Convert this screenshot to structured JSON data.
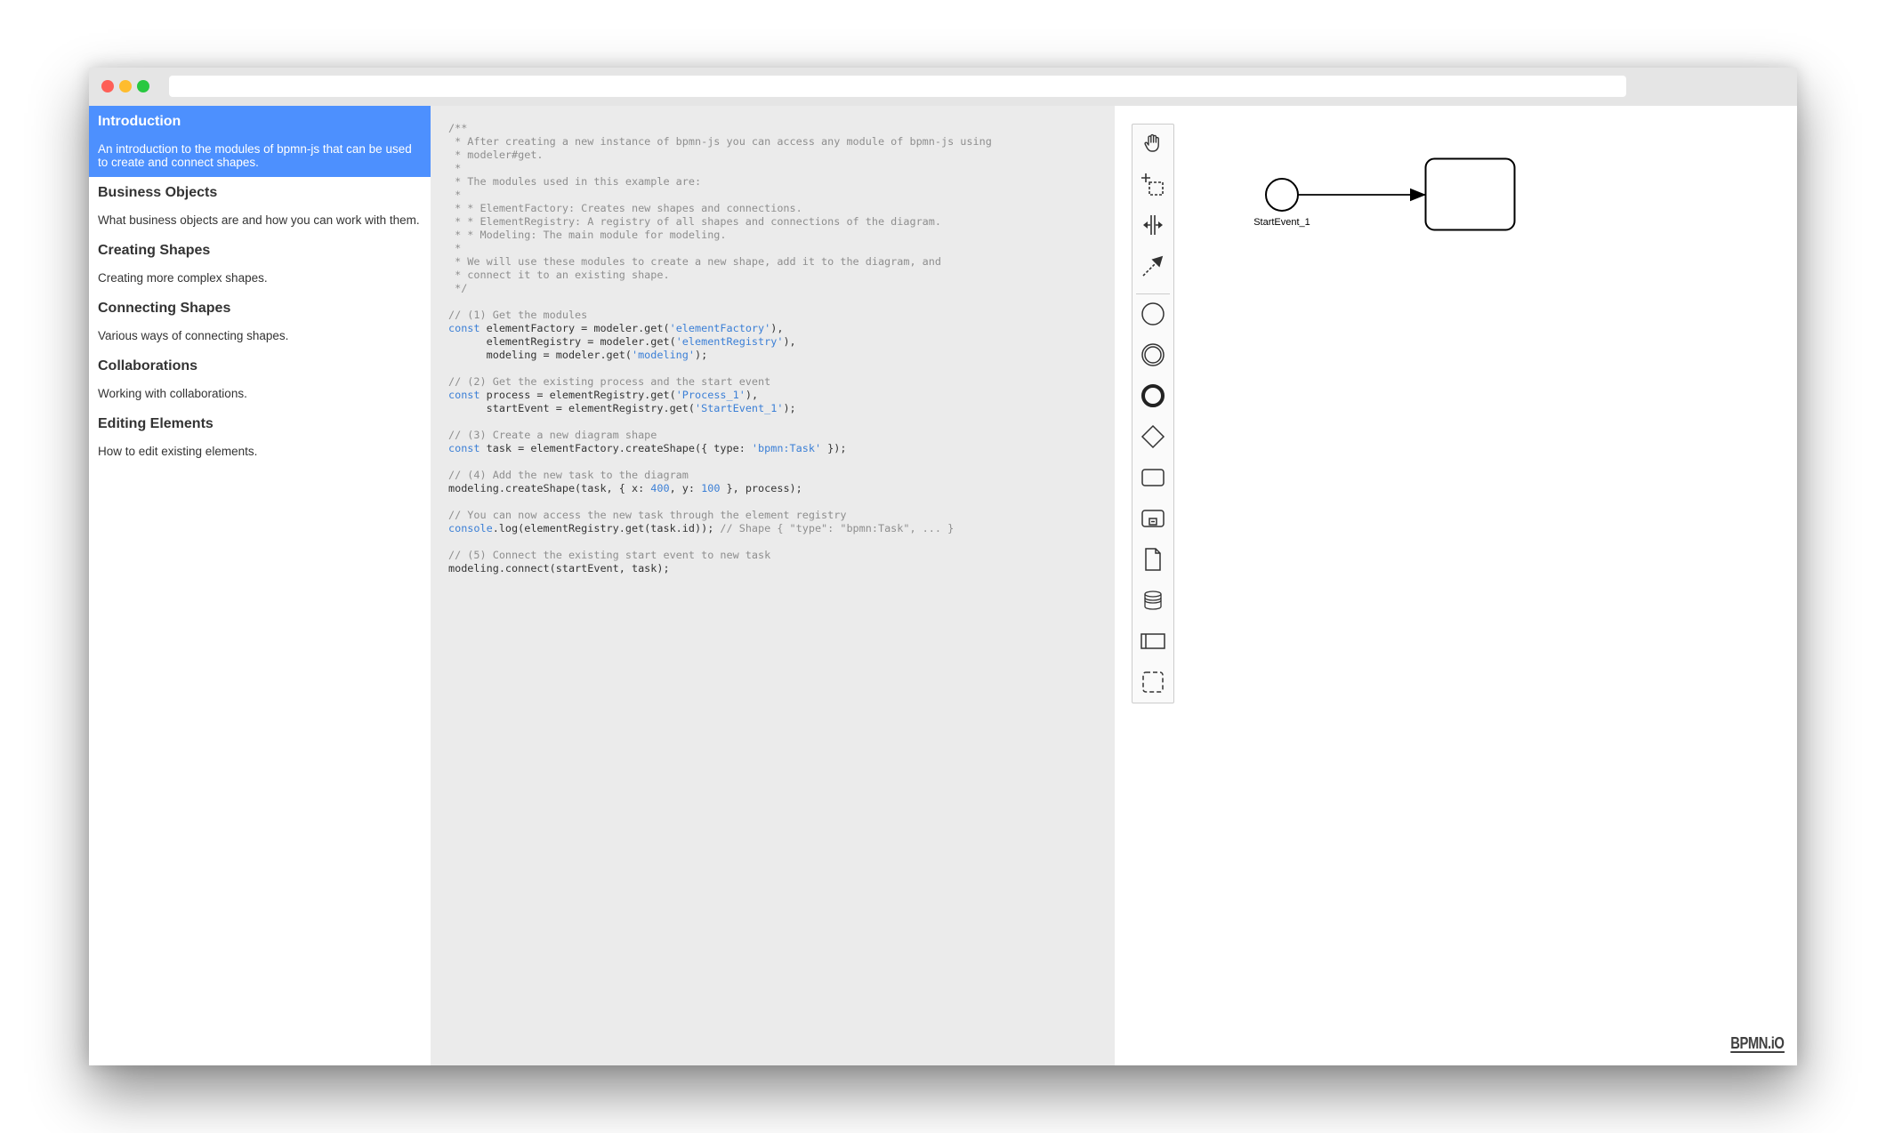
{
  "nav": {
    "items": [
      {
        "title": "Introduction",
        "desc": "An introduction to the modules of bpmn-js that can be used to create and connect shapes."
      },
      {
        "title": "Business Objects",
        "desc": "What business objects are and how you can work with them."
      },
      {
        "title": "Creating Shapes",
        "desc": "Creating more complex shapes."
      },
      {
        "title": "Connecting Shapes",
        "desc": "Various ways of connecting shapes."
      },
      {
        "title": "Collaborations",
        "desc": "Working with collaborations."
      },
      {
        "title": "Editing Elements",
        "desc": "How to edit existing elements."
      }
    ],
    "active_index": 0
  },
  "code": {
    "l01": "/**",
    "l02": " * After creating a new instance of bpmn-js you can access any module of bpmn-js using",
    "l03": " * modeler#get.",
    "l04": " *",
    "l05": " * The modules used in this example are:",
    "l06": " *",
    "l07": " * * ElementFactory: Creates new shapes and connections.",
    "l08": " * * ElementRegistry: A registry of all shapes and connections of the diagram.",
    "l09": " * * Modeling: The main module for modeling.",
    "l10": " *",
    "l11": " * We will use these modules to create a new shape, add it to the diagram, and",
    "l12": " * connect it to an existing shape.",
    "l13": " */",
    "c1": "// (1) Get the modules",
    "kw_const": "const",
    "s1a": " elementFactory = modeler.get(",
    "s1a_str": "'elementFactory'",
    "s1a_end": "),",
    "s1b": "      elementRegistry = modeler.get(",
    "s1b_str": "'elementRegistry'",
    "s1b_end": "),",
    "s1c": "      modeling = modeler.get(",
    "s1c_str": "'modeling'",
    "s1c_end": ");",
    "c2": "// (2) Get the existing process and the start event",
    "s2a": " process = elementRegistry.get(",
    "s2a_str": "'Process_1'",
    "s2a_end": "),",
    "s2b": "      startEvent = elementRegistry.get(",
    "s2b_str": "'StartEvent_1'",
    "s2b_end": ");",
    "c3": "// (3) Create a new diagram shape",
    "s3": " task = elementFactory.createShape({ type: ",
    "s3_str": "'bpmn:Task'",
    "s3_end": " });",
    "c4": "// (4) Add the new task to the diagram",
    "s4a": "modeling.createShape(task, { x: ",
    "s4_x": "400",
    "s4b": ", y: ",
    "s4_y": "100",
    "s4c": " }, process);",
    "c5": "// You can now access the new task through the element registry",
    "kw_console": "console",
    "s5": ".log(elementRegistry.get(task.id)); ",
    "s5_com": "// Shape { \"type\": \"bpmn:Task\", ... }",
    "c6": "// (5) Connect the existing start event to new task",
    "s6": "modeling.connect(startEvent, task);"
  },
  "palette": {
    "tools": [
      {
        "name": "hand-tool-icon"
      },
      {
        "name": "lasso-tool-icon"
      },
      {
        "name": "space-tool-icon"
      },
      {
        "name": "global-connect-tool-icon"
      },
      {
        "name": "start-event-icon"
      },
      {
        "name": "intermediate-event-icon"
      },
      {
        "name": "end-event-icon"
      },
      {
        "name": "gateway-icon"
      },
      {
        "name": "task-icon"
      },
      {
        "name": "subprocess-icon"
      },
      {
        "name": "data-object-icon"
      },
      {
        "name": "data-store-icon"
      },
      {
        "name": "participant-icon"
      },
      {
        "name": "group-icon"
      }
    ]
  },
  "diagram": {
    "start_event_label": "StartEvent_1"
  },
  "watermark": "BPMN.iO"
}
